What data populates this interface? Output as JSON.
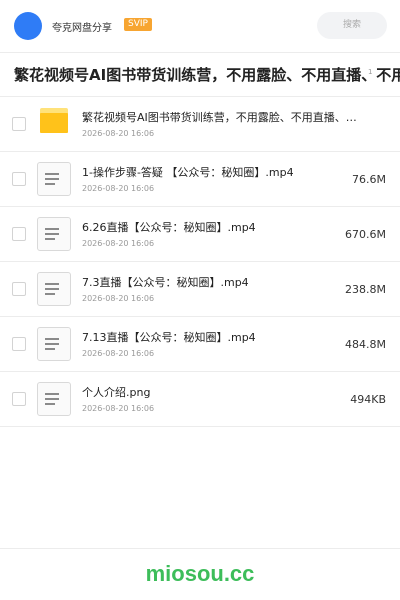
{
  "header": {
    "brand": "夸克网盘分享",
    "badge": "SVIP",
    "search_label": "搜索"
  },
  "title": {
    "text": "繁花视频号AI图书带货训练营，不用露脸、不用直播、不用",
    "count": "1"
  },
  "files": [
    {
      "name": "繁花视频号AI图书带货训练营，不用露脸、不用直播、…",
      "date": "2026-08-20 16:06",
      "size": "",
      "type": "folder"
    },
    {
      "name": "1-操作步骤-答疑 【公众号：秘知圈】.mp4",
      "date": "2026-08-20 16:06",
      "size": "76.6M",
      "type": "file"
    },
    {
      "name": "6.26直播【公众号：秘知圈】.mp4",
      "date": "2026-08-20 16:06",
      "size": "670.6M",
      "type": "file"
    },
    {
      "name": "7.3直播【公众号：秘知圈】.mp4",
      "date": "2026-08-20 16:06",
      "size": "238.8M",
      "type": "file"
    },
    {
      "name": "7.13直播【公众号：秘知圈】.mp4",
      "date": "2026-08-20 16:06",
      "size": "484.8M",
      "type": "file"
    },
    {
      "name": "个人介绍.png",
      "date": "2026-08-20 16:06",
      "size": "494KB",
      "type": "file"
    }
  ],
  "footer": {
    "watermark": "miosou.cc"
  },
  "colors": {
    "avatar": "#2f7cf6",
    "badge": "#f7a531",
    "folder": "#ffc21a",
    "watermark": "#3dbd5a"
  }
}
